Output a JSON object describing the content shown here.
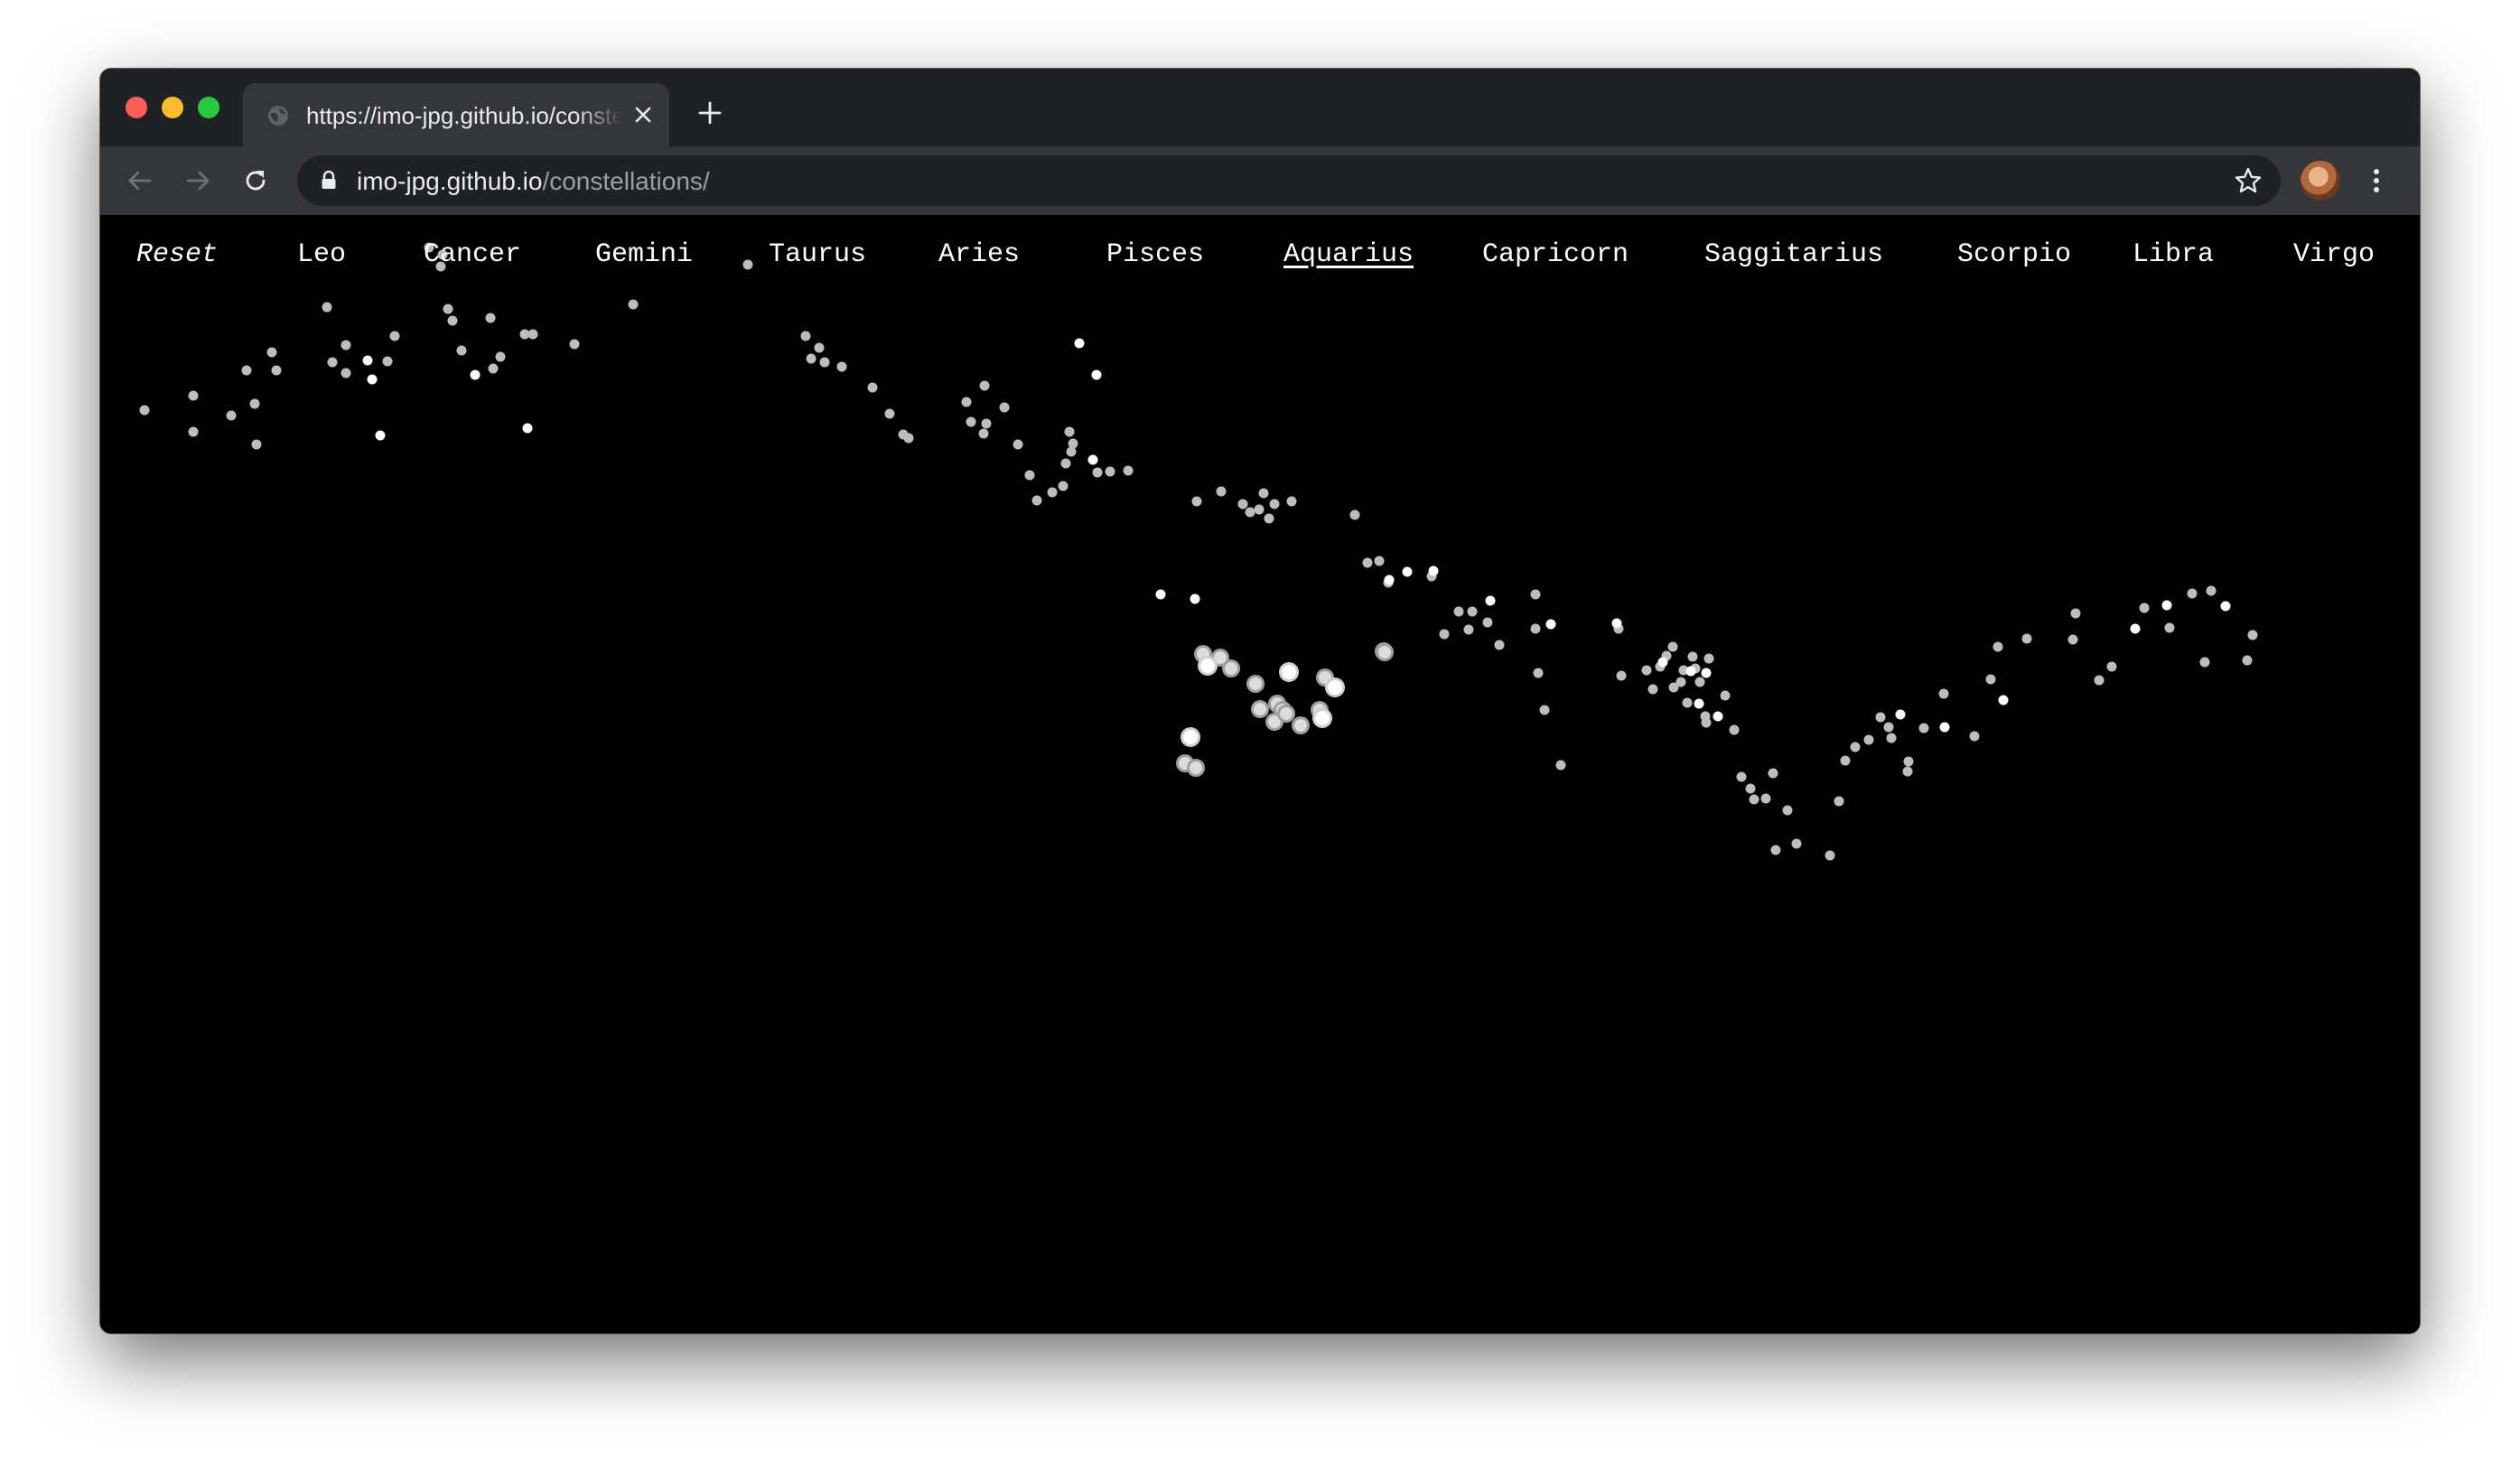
{
  "browser": {
    "tab_title": "https://imo-jpg.github.io/constellations/",
    "url_host": "imo-jpg.github.io",
    "url_path": "/constellations/"
  },
  "nav": {
    "items": [
      "Reset",
      "Leo",
      "Cancer",
      "Gemini",
      "Taurus",
      "Aries",
      "Pisces",
      "Aquarius",
      "Capricorn",
      "Saggitarius",
      "Scorpio",
      "Libra",
      "Virgo"
    ],
    "active": "Aquarius"
  },
  "colors": {
    "page_bg": "#000000",
    "nav_text": "#ffffff",
    "star_dim": "#bdbdbd",
    "star_bright": "#ffffff",
    "star_highlight": "#9e9e9e"
  }
}
